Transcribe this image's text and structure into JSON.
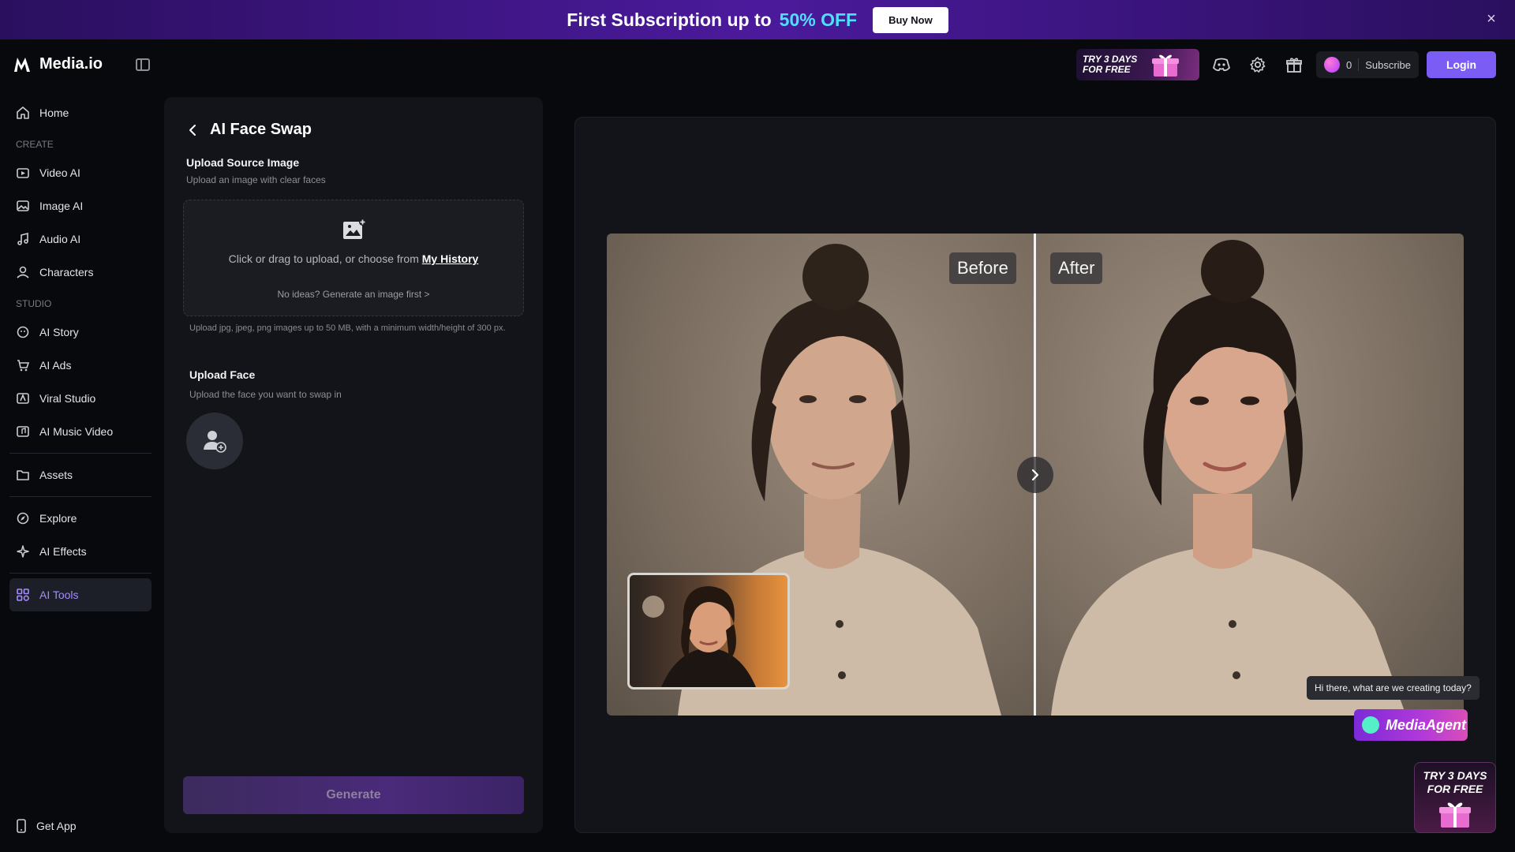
{
  "promo": {
    "text": "First Subscription up to",
    "highlight": "50% OFF",
    "button": "Buy Now",
    "close_icon": "×"
  },
  "brand": {
    "name": "Media.io"
  },
  "header": {
    "trial_badge": "TRY 3 DAYS FOR FREE",
    "credits": "0",
    "subscribe": "Subscribe",
    "login": "Login"
  },
  "nav": {
    "home": "Home",
    "section_create": "CREATE",
    "video_ai": "Video AI",
    "image_ai": "Image AI",
    "audio_ai": "Audio AI",
    "characters": "Characters",
    "section_studio": "STUDIO",
    "ai_story": "AI Story",
    "ai_ads": "AI Ads",
    "viral_studio": "Viral Studio",
    "ai_music_video": "AI Music Video",
    "assets": "Assets",
    "explore": "Explore",
    "ai_effects": "AI Effects",
    "ai_tools": "AI Tools",
    "get_app": "Get App"
  },
  "panel": {
    "title": "AI Face Swap",
    "source_label": "Upload Source Image",
    "source_sub": "Upload an image with clear faces",
    "dropzone_text": "Click or drag to upload, or choose from",
    "dropzone_link": "My History",
    "dropzone_hint": "No ideas? Generate an image first >",
    "upload_note": "Upload jpg, jpeg, png images up to 50 MB, with a minimum width/height of 300 px.",
    "face_label": "Upload Face",
    "face_sub": "Upload the face you want to swap in",
    "generate": "Generate"
  },
  "preview": {
    "before": "Before",
    "after": "After"
  },
  "agent": {
    "bubble": "Hi there, what are we creating today?",
    "name": "MediaAgent"
  },
  "float_trial": "TRY 3 DAYS FOR FREE",
  "colors": {
    "accent": "#7b5cf5",
    "active_nav": "#a58cff",
    "promo_highlight": "#4fe0ff"
  }
}
